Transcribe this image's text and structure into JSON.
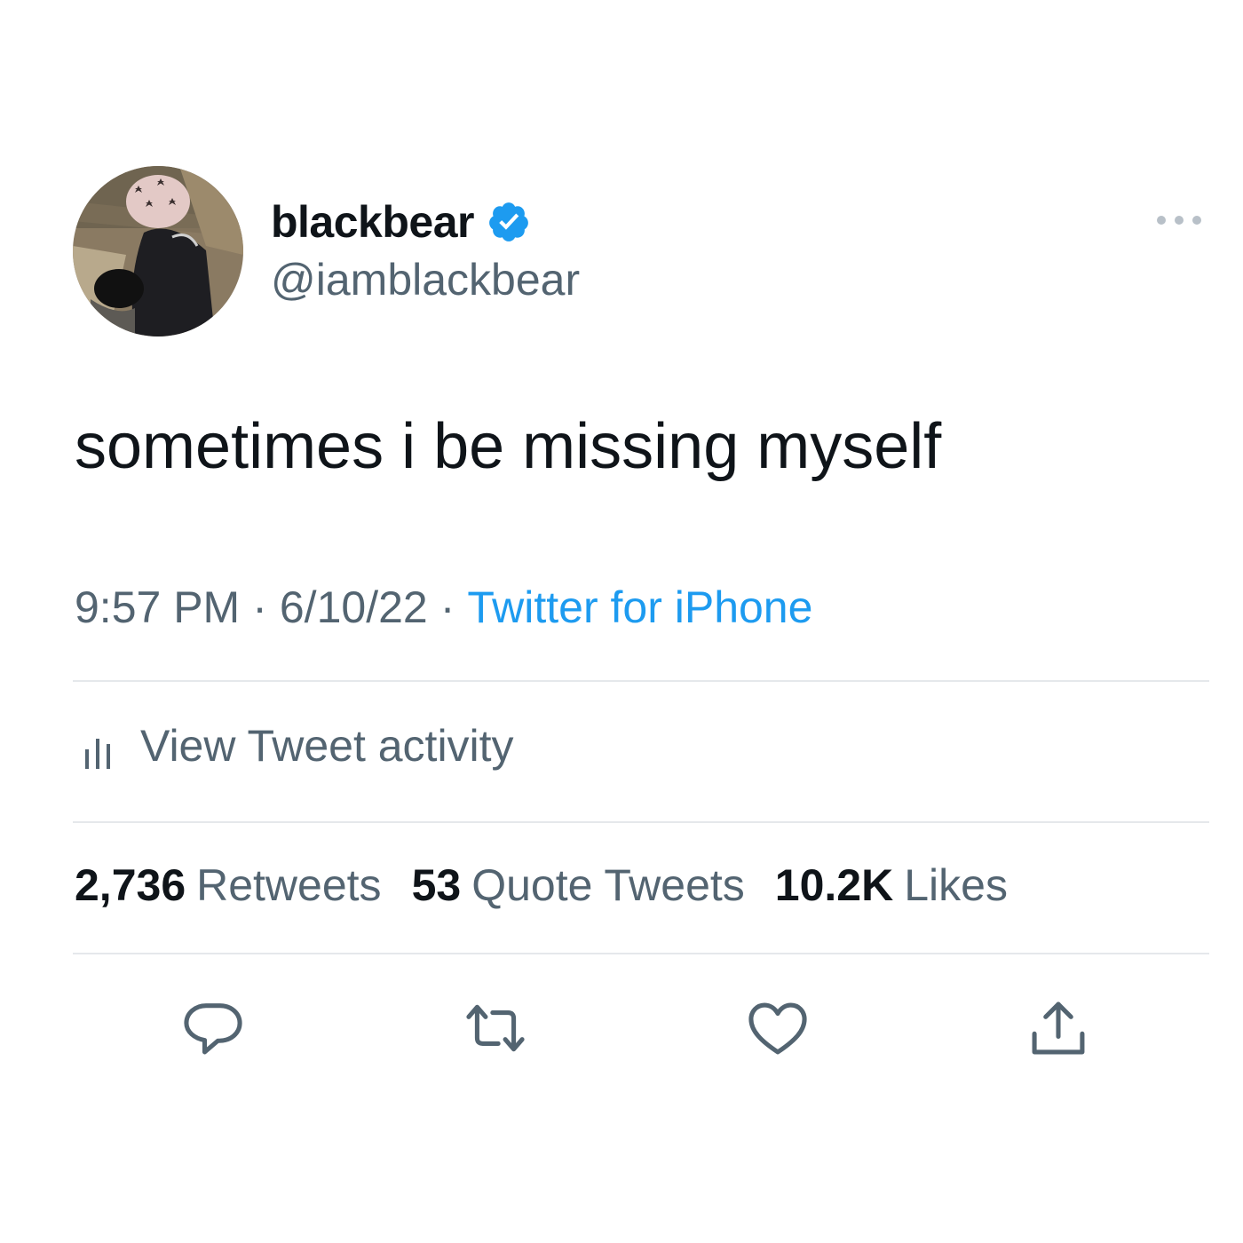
{
  "author": {
    "display_name": "blackbear",
    "handle": "@iamblackbear",
    "verified": true,
    "verified_color": "#1d9bf0"
  },
  "tweet": {
    "text": "sometimes i be missing myself",
    "time": "9:57 PM",
    "date": "6/10/22",
    "separator": "·",
    "source": "Twitter for iPhone"
  },
  "activity": {
    "label": "View Tweet activity"
  },
  "stats": {
    "retweets_count": "2,736",
    "retweets_label": "Retweets",
    "quotes_count": "53",
    "quotes_label": "Quote Tweets",
    "likes_count": "10.2K",
    "likes_label": "Likes"
  },
  "icons": {
    "more": "more-dots-icon",
    "reply": "reply-icon",
    "retweet": "retweet-icon",
    "like": "heart-icon",
    "share": "share-icon",
    "activity": "bar-chart-icon"
  },
  "colors": {
    "text_primary": "#0f1419",
    "text_secondary": "#536471",
    "accent": "#1d9bf0",
    "divider": "#e5e8eb"
  }
}
